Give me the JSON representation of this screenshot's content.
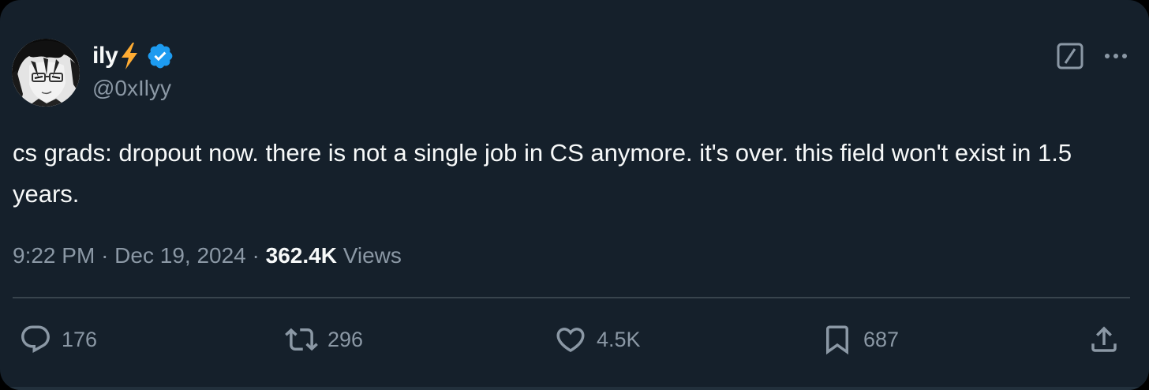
{
  "author": {
    "display_name": "ily",
    "display_name_emoji": "lightning-bolt",
    "verified": true,
    "handle": "@0xIlyy",
    "avatar": "anime-character-avatar"
  },
  "header_actions": {
    "grok_icon": "grok-icon",
    "more_icon": "more-dots-icon"
  },
  "tweet": {
    "text": "cs grads: dropout now. there is not a single job in CS anymore. it's over. this field won't exist in 1.5 years.",
    "time": "9:22 PM",
    "separator": "·",
    "date": "Dec 19, 2024",
    "views_count": "362.4K",
    "views_label": "Views"
  },
  "actions": {
    "replies": "176",
    "retweets": "296",
    "likes": "4.5K",
    "bookmarks": "687"
  },
  "colors": {
    "background": "#15202b",
    "text_primary": "#f7f9f9",
    "text_secondary": "#8b98a5",
    "verified_blue": "#1d9bf0",
    "bolt_yellow": "#ffac33",
    "divider": "#38444d"
  }
}
